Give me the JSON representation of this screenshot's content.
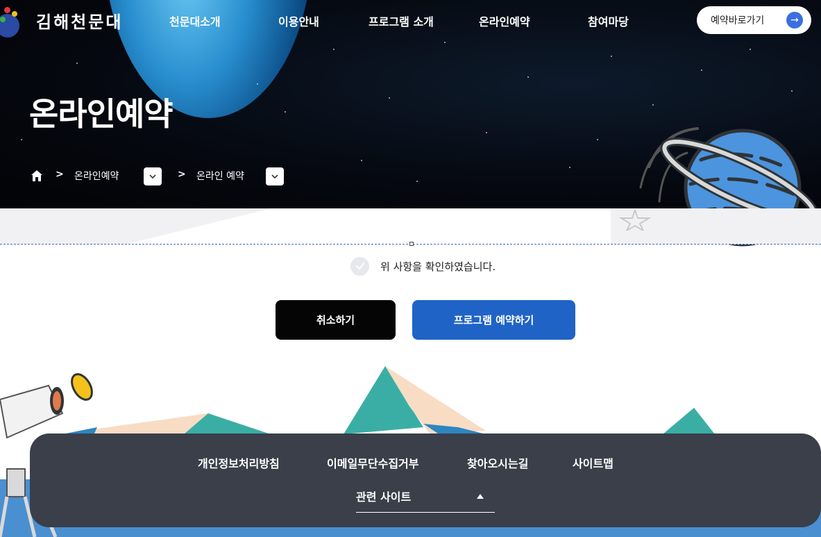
{
  "header": {
    "logo_text": "김해천문대",
    "nav": [
      "천문대소개",
      "이용안내",
      "프로그램 소개",
      "온라인예약",
      "참여마당"
    ],
    "quick_button": "예약바로가기"
  },
  "hero": {
    "title": "온라인예약",
    "breadcrumb": [
      "온라인예약",
      "온라인 예약"
    ],
    "separator": ">"
  },
  "form": {
    "confirm_text": "위 사항을 확인하였습니다.",
    "confirm_checked": false,
    "cancel_label": "취소하기",
    "reserve_label": "프로그램 예약하기"
  },
  "footer": {
    "links": [
      "개인정보처리방침",
      "이메일무단수집거부",
      "찾아오시는길",
      "사이트맵"
    ],
    "related_label": "관련 사이트"
  },
  "colors": {
    "reserve_button": "#1f63c6",
    "cancel_button": "#050505",
    "footer_bg": "#3a3f4a",
    "quick_arrow": "#3b6fe0"
  },
  "icons": [
    "home-icon",
    "chevron-down-icon",
    "arrow-right-icon",
    "check-icon",
    "triangle-up-icon"
  ]
}
